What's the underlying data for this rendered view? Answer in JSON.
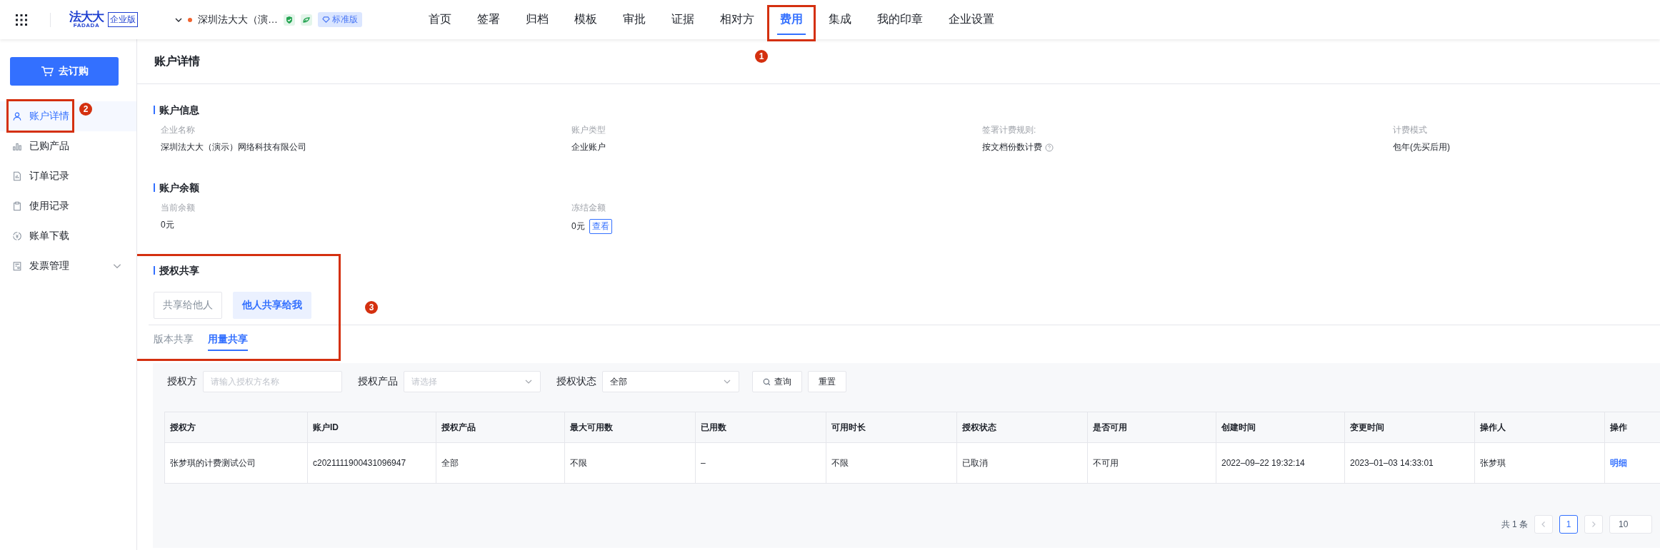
{
  "header": {
    "logo": {
      "name": "法大大",
      "latin": "FADADA",
      "edition": "企业版"
    },
    "org": {
      "name": "深圳法大大（演…",
      "plan": "标准版"
    },
    "nav": [
      {
        "label": "首页",
        "selected": false
      },
      {
        "label": "签署",
        "selected": false
      },
      {
        "label": "归档",
        "selected": false
      },
      {
        "label": "模板",
        "selected": false
      },
      {
        "label": "审批",
        "selected": false
      },
      {
        "label": "证据",
        "selected": false
      },
      {
        "label": "相对方",
        "selected": false
      },
      {
        "label": "费用",
        "selected": true,
        "callout": "1"
      },
      {
        "label": "集成",
        "selected": false
      },
      {
        "label": "我的印章",
        "selected": false
      },
      {
        "label": "企业设置",
        "selected": false
      }
    ]
  },
  "sidebar": {
    "buy_button": "去订购",
    "items": [
      {
        "label": "账户详情",
        "selected": true,
        "callout": "2"
      },
      {
        "label": "已购产品",
        "selected": false
      },
      {
        "label": "订单记录",
        "selected": false
      },
      {
        "label": "使用记录",
        "selected": false
      },
      {
        "label": "账单下载",
        "selected": false
      },
      {
        "label": "发票管理",
        "selected": false,
        "expanded": false
      }
    ]
  },
  "page_title": "账户详情",
  "account_info": {
    "title": "账户信息",
    "fields": [
      {
        "label": "企业名称",
        "value": "深圳法大大（演示）网络科技有限公司",
        "has_help": false
      },
      {
        "label": "账户类型",
        "value": "企业账户",
        "has_help": false
      },
      {
        "label": "签署计费规则:",
        "value": "按文档份数计费",
        "has_help": true
      },
      {
        "label": "计费模式",
        "value": "包年(先买后用)",
        "has_help": false
      }
    ]
  },
  "balance": {
    "title": "账户余额",
    "fields": [
      {
        "label": "当前余额",
        "value": "0元"
      },
      {
        "label": "冻结金额",
        "value": "0元",
        "action": "查看"
      }
    ]
  },
  "sharing": {
    "title": "授权共享",
    "callout": "3",
    "toggles": [
      {
        "label": "共享给他人",
        "selected": false
      },
      {
        "label": "他人共享给我",
        "selected": true
      }
    ],
    "subtabs": [
      {
        "label": "版本共享",
        "selected": false
      },
      {
        "label": "用量共享",
        "selected": true
      }
    ],
    "filters": [
      {
        "label": "授权方",
        "kind": "input",
        "placeholder": "请输入授权方名称"
      },
      {
        "label": "授权产品",
        "kind": "select",
        "placeholder": "请选择"
      },
      {
        "label": "授权状态",
        "kind": "select",
        "value": "全部"
      }
    ],
    "buttons": [
      {
        "label": "查询",
        "kind": "search"
      },
      {
        "label": "重置",
        "kind": "plain"
      }
    ],
    "table": {
      "columns": [
        "授权方",
        "账户ID",
        "授权产品",
        "最大可用数",
        "已用数",
        "可用时长",
        "授权状态",
        "是否可用",
        "创建时间",
        "变更时间",
        "操作人",
        "操作"
      ],
      "rows": [
        [
          "张梦琪的计费测试公司",
          "c2021111900431096947",
          "全部",
          "不限",
          "–",
          "不限",
          "已取消",
          "不可用",
          "2022–09–22 19:32:14",
          "2023–01–03 14:33:01",
          "张梦琪",
          "明细"
        ]
      ]
    },
    "pagination": {
      "total": "共 1 条",
      "pages": [
        {
          "label": "1",
          "selected": true
        }
      ],
      "page_size": "10"
    }
  }
}
